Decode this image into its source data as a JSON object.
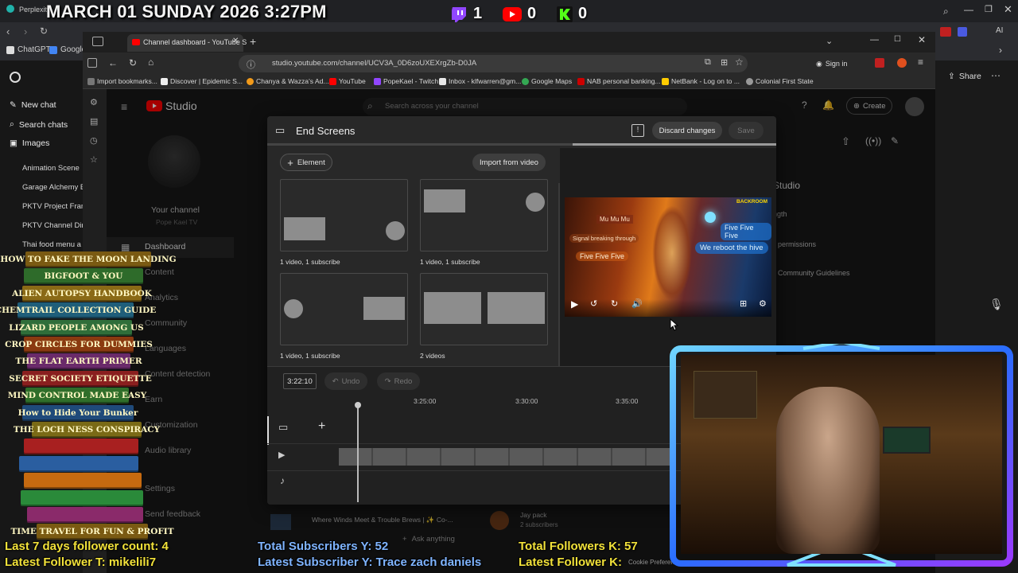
{
  "stream": {
    "date_text": "MARCH 01 SUNDAY 2026 3:27PM",
    "twitch_count": "1",
    "youtube_count": "0",
    "kick_count": "0",
    "follower_7day": "Last 7 days follower count: 4",
    "latest_follower_twitch": "Latest Follower T: mikelili7",
    "total_subs_yt": "Total Subscribers Y: 52",
    "latest_sub_yt": "Latest Subscriber Y: Trace zach daniels",
    "total_followers_kick": "Total Followers K: 57",
    "latest_follower_kick": "Latest Follower K:",
    "colors": {
      "twitch": "#9146ff",
      "youtube": "#ff0000",
      "kick": "#53fc18",
      "stat_yellow": "#f2e23a",
      "stat_blue": "#7fb4ff"
    }
  },
  "outer_browser": {
    "tab_perplexity": "Perplexity",
    "bookmarks": [
      "ChatGPT",
      "Google"
    ]
  },
  "chatgpt_sidebar": {
    "new_chat": "New chat",
    "search_chats": "Search chats",
    "images": "Images",
    "history": [
      "Animation Scene",
      "Garage Alchemy B",
      "PKTV Project Fran",
      "PKTV Channel Dir",
      "Thai food menu a"
    ]
  },
  "inner_browser": {
    "tab_title": "Channel dashboard - YouTube S",
    "url": "studio.youtube.com/channel/UCV3A_0D6zoUXEXrgZb-D0JA",
    "sign_in": "Sign in",
    "bookmarks": [
      "Import bookmarks...",
      "Discover | Epidemic S...",
      "Chanya & Wazza's Ad...",
      "YouTube",
      "PopeKael - Twitch",
      "Inbox - klfwarren@gm...",
      "Google Maps",
      "NAB personal banking...",
      "NetBank - Log on to ...",
      "Colonial First State"
    ],
    "share": "Share"
  },
  "studio": {
    "logo_text": "Studio",
    "search_placeholder": "Search across your channel",
    "create": "Create",
    "your_channel": "Your channel",
    "channel_name": "Pope Kael TV",
    "nav": [
      "Dashboard",
      "Content",
      "Analytics",
      "Community",
      "Languages",
      "Content detection",
      "Earn",
      "Customization",
      "Audio library",
      "Settings",
      "Send feedback"
    ],
    "right_panel_title": "Studio",
    "right_links": [
      "permissions",
      "Community Guidelines"
    ],
    "right_length": "ngth",
    "bottom_video": "Where Winds Meet & Trouble Brews | ✨ Co-...",
    "bottom_user": "Jay pack",
    "bottom_user_subs": "2 subscribers",
    "ask_anything": "Ask anything",
    "cookie_text": "Cookie Preferences"
  },
  "end_screens": {
    "title": "End Screens",
    "discard": "Discard changes",
    "save": "Save",
    "element": "Element",
    "import": "Import from video",
    "templates": [
      {
        "caption": "1 video, 1 subscribe"
      },
      {
        "caption": "1 video, 1 subscribe"
      },
      {
        "caption": "1 video, 1 subscribe"
      },
      {
        "caption": "2 videos"
      }
    ],
    "time": "3:22:10",
    "undo": "Undo",
    "redo": "Redo",
    "ruler": [
      "3:25:00",
      "3:30:00",
      "3:35:00"
    ],
    "preview": {
      "badge": "BACKROOM",
      "label1": "Mu Mu Mu",
      "label2": "Signal breaking through",
      "label3": "Five Five Five",
      "label4": "Five Five Five",
      "label5": "We reboot the hive"
    }
  },
  "books": [
    {
      "title": "HOW TO FAKE THE MOON LANDING",
      "color": "#7a5a12"
    },
    {
      "title": "BIGFOOT & YOU",
      "color": "#2e6b2a"
    },
    {
      "title": "ALIEN AUTOPSY HANDBOOK",
      "color": "#8a6a16"
    },
    {
      "title": "CHEMTRAIL COLLECTION GUIDE",
      "color": "#1f5e7a"
    },
    {
      "title": "LIZARD PEOPLE AMONG US",
      "color": "#2f6e3a"
    },
    {
      "title": "CROP CIRCLES FOR DUMMIES",
      "color": "#8a3a10"
    },
    {
      "title": "THE FLAT EARTH PRIMER",
      "color": "#6a2a6a"
    },
    {
      "title": "SECRET SOCIETY ETIQUETTE",
      "color": "#8a1f1f"
    },
    {
      "title": "MIND CONTROL MADE EASY",
      "color": "#2f6e2a"
    },
    {
      "title": "How to Hide Your Bunker",
      "color": "#1f4a7a"
    },
    {
      "title": "THE LOCH NESS CONSPIRACY",
      "color": "#7a6a16"
    },
    {
      "title": "",
      "color": "#a82020"
    },
    {
      "title": "",
      "color": "#2a5ea0"
    },
    {
      "title": "",
      "color": "#c66a10"
    },
    {
      "title": "",
      "color": "#2a8a3a"
    },
    {
      "title": "",
      "color": "#8a2a6a"
    },
    {
      "title": "TIME TRAVEL FOR FUN & PROFIT",
      "color": "#7a5a12"
    }
  ]
}
